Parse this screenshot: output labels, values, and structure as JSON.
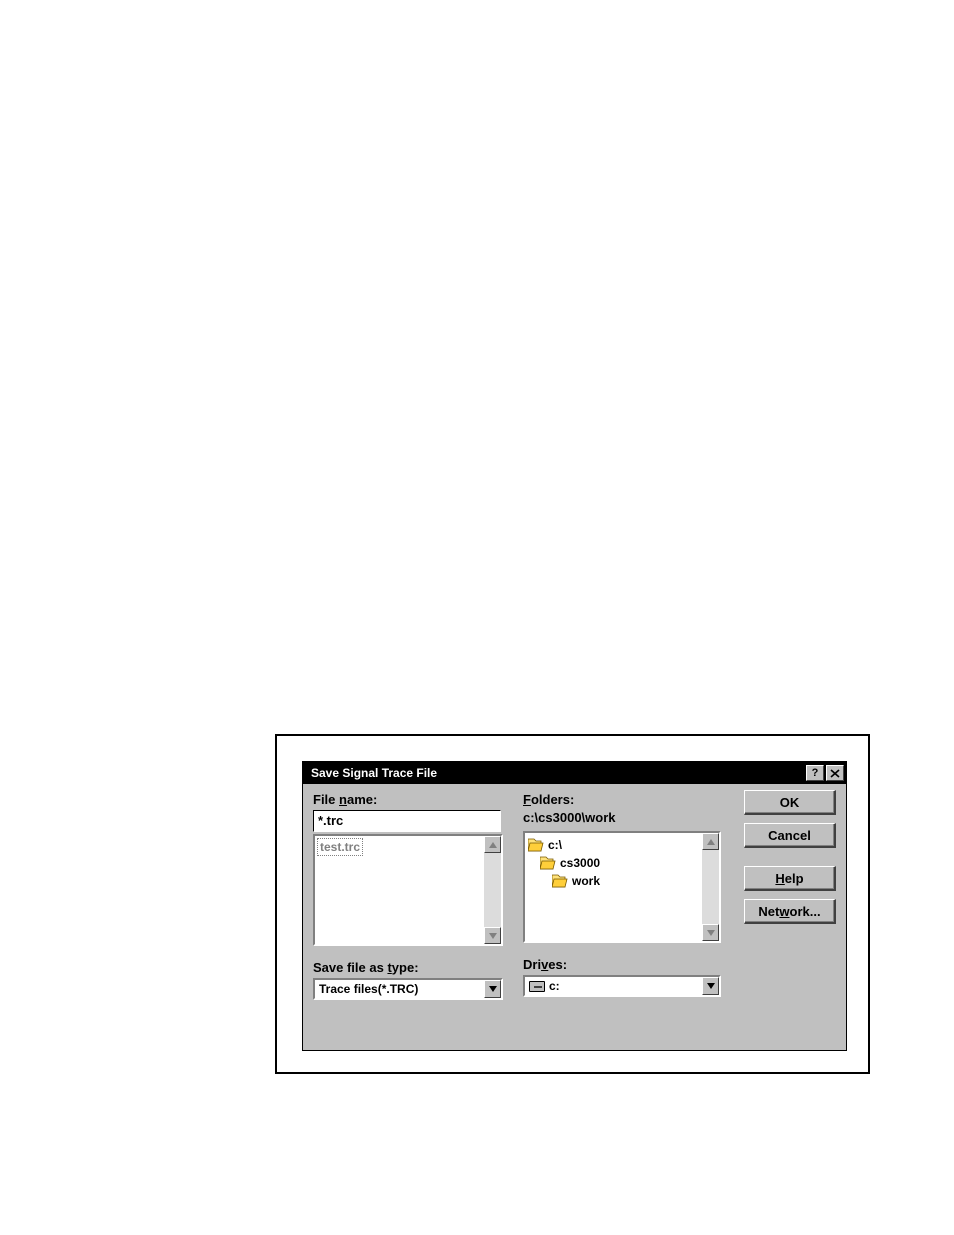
{
  "dialog": {
    "title": "Save Signal Trace File",
    "filename_label_pre": "File ",
    "filename_label_u": "n",
    "filename_label_post": "ame:",
    "filename_value": "*.trc",
    "file_list": [
      "test.trc"
    ],
    "folders_label_u": "F",
    "folders_label_post": "olders:",
    "current_path": "c:\\cs3000\\work",
    "tree": [
      {
        "indent": 0,
        "label": "c:\\"
      },
      {
        "indent": 1,
        "label": "cs3000"
      },
      {
        "indent": 2,
        "label": "work"
      }
    ],
    "type_label_pre": "Save file as ",
    "type_label_u": "t",
    "type_label_post": "ype:",
    "type_value": "Trace files(*.TRC)",
    "drives_label_pre": "Dri",
    "drives_label_u": "v",
    "drives_label_post": "es:",
    "drive_value": "c:",
    "buttons": {
      "ok": "OK",
      "cancel": "Cancel",
      "help_pre": "",
      "help_u": "H",
      "help_post": "elp",
      "network_pre": "Net",
      "network_u": "w",
      "network_post": "ork..."
    }
  }
}
